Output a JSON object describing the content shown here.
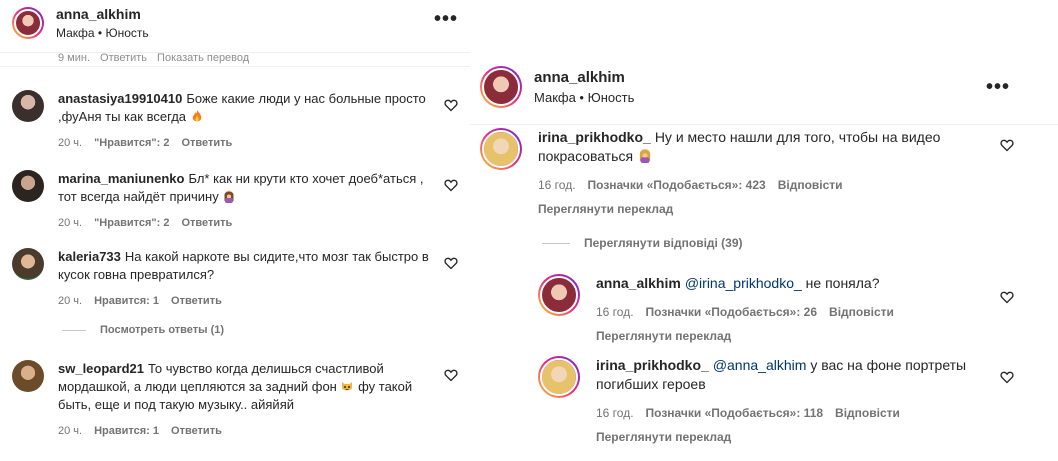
{
  "left": {
    "header": {
      "username": "anna_alkhim",
      "subtitle": "Макфа • Юность",
      "more": "•••"
    },
    "top_cut": {
      "time": "9 мин.",
      "reply": "Ответить",
      "translate": "Показать перевод"
    },
    "comments": [
      {
        "username": "anastasiya19910410",
        "text": "Боже какие люди у нас больные просто ,фуАня ты как всегда",
        "emoji": "fire-icon",
        "time": "20 ч.",
        "likes": "\"Нравится\": 2",
        "reply": "Ответить"
      },
      {
        "username": "marina_maniunenko",
        "text": "Бл* как ни крути кто хочет доеб*аться , тот всегда найдёт причину",
        "emoji": "woman-facepalming-icon",
        "time": "20 ч.",
        "likes": "\"Нравится\": 2",
        "reply": "Ответить"
      },
      {
        "username": "kaleria733",
        "text": "На какой наркоте вы сидите,что мозг так быстро в кусок говна превратился?",
        "time": "20 ч.",
        "likes": "Нравится: 1",
        "reply": "Ответить"
      },
      {
        "username": "sw_leopard21",
        "text_a": "То чувство когда делишься счастливой мордашкой, а люди цепляются за задний фон",
        "text_b": "фу такой быть, еще и под такую музыку.. айяйяй",
        "emoji": "cat-face-icon",
        "time": "20 ч.",
        "likes": "Нравится: 1",
        "reply": "Ответить"
      }
    ],
    "view_replies": "Посмотреть ответы (1)"
  },
  "right": {
    "header": {
      "username": "anna_alkhim",
      "subtitle": "Макфа • Юность",
      "more": "•••"
    },
    "comment": {
      "username": "irina_prikhodko_",
      "text": "Ну и место нашли для того, чтобы на видео покрасоваться",
      "emoji": "woman-facepalming-icon",
      "time": "16 год.",
      "likes": "Позначки «Подобається»: 423",
      "reply": "Відповісти",
      "translate": "Переглянути переклад"
    },
    "view_replies": "Переглянути відповіді (39)",
    "replies": [
      {
        "username": "anna_alkhim",
        "mention": "@irina_prikhodko_",
        "text": "не поняла?",
        "time": "16 год.",
        "likes": "Позначки «Подобається»: 26",
        "reply": "Відповісти",
        "translate": "Переглянути переклад"
      },
      {
        "username": "irina_prikhodko_",
        "mention": "@anna_alkhim",
        "text": "у вас на фоне портреты погибших героев",
        "time": "16 год.",
        "likes": "Позначки «Подобається»: 118",
        "reply": "Відповісти",
        "translate": "Переглянути переклад"
      }
    ]
  }
}
